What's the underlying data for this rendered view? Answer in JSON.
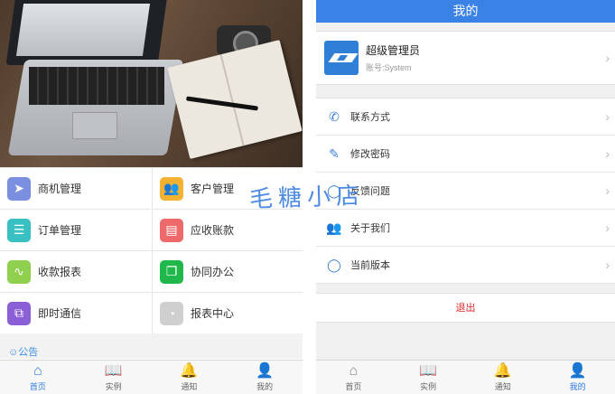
{
  "left": {
    "grid": [
      {
        "label": "商机管理",
        "color": "#7a8fe0",
        "icon": "paper-plane-icon",
        "glyph": "➤"
      },
      {
        "label": "客户管理",
        "color": "#f5b232",
        "icon": "group-icon",
        "glyph": "👥"
      },
      {
        "label": "订单管理",
        "color": "#38c0c2",
        "icon": "list-icon",
        "glyph": "☰"
      },
      {
        "label": "应收账款",
        "color": "#ee6a6a",
        "icon": "money-icon",
        "glyph": "▤"
      },
      {
        "label": "收款报表",
        "color": "#8fd04f",
        "icon": "pulse-icon",
        "glyph": "∿"
      },
      {
        "label": "协同办公",
        "color": "#21b84b",
        "icon": "copy-icon",
        "glyph": "❐"
      },
      {
        "label": "即时通信",
        "color": "#8b5fd6",
        "icon": "chat-icon",
        "glyph": "⧉"
      },
      {
        "label": "报表中心",
        "color": "#cfcfcf",
        "icon": "pie-chart-icon",
        "glyph": "◔"
      }
    ],
    "notice": "☺公告",
    "tabs": [
      {
        "label": "首页",
        "icon": "home-icon",
        "glyph": "⌂",
        "active": true
      },
      {
        "label": "实例",
        "icon": "book-icon",
        "glyph": "📖",
        "active": false
      },
      {
        "label": "通知",
        "icon": "bell-icon",
        "glyph": "🔔",
        "active": false
      },
      {
        "label": "我的",
        "icon": "user-icon",
        "glyph": "👤",
        "active": false
      }
    ]
  },
  "right": {
    "title": "我的",
    "profile": {
      "name": "超级管理员",
      "account": "账号:System"
    },
    "menu": [
      {
        "label": "联系方式",
        "icon": "phone-icon",
        "glyph": "✆"
      },
      {
        "label": "修改密码",
        "icon": "edit-icon",
        "glyph": "✎"
      },
      {
        "label": "反馈问题",
        "icon": "feedback-icon",
        "glyph": "◯"
      },
      {
        "label": "关于我们",
        "icon": "team-icon",
        "glyph": "👥"
      },
      {
        "label": "当前版本",
        "icon": "message-icon",
        "glyph": "◯"
      }
    ],
    "logout": "退出",
    "tabs": [
      {
        "label": "首页",
        "icon": "home-icon",
        "glyph": "⌂",
        "active": false
      },
      {
        "label": "实例",
        "icon": "book-icon",
        "glyph": "📖",
        "active": false
      },
      {
        "label": "通知",
        "icon": "bell-icon",
        "glyph": "🔔",
        "active": false
      },
      {
        "label": "我的",
        "icon": "user-icon",
        "glyph": "👤",
        "active": true
      }
    ]
  },
  "watermark": "毛糖小店",
  "colors": {
    "accent": "#3b82e6",
    "logout": "#e02b2b"
  }
}
